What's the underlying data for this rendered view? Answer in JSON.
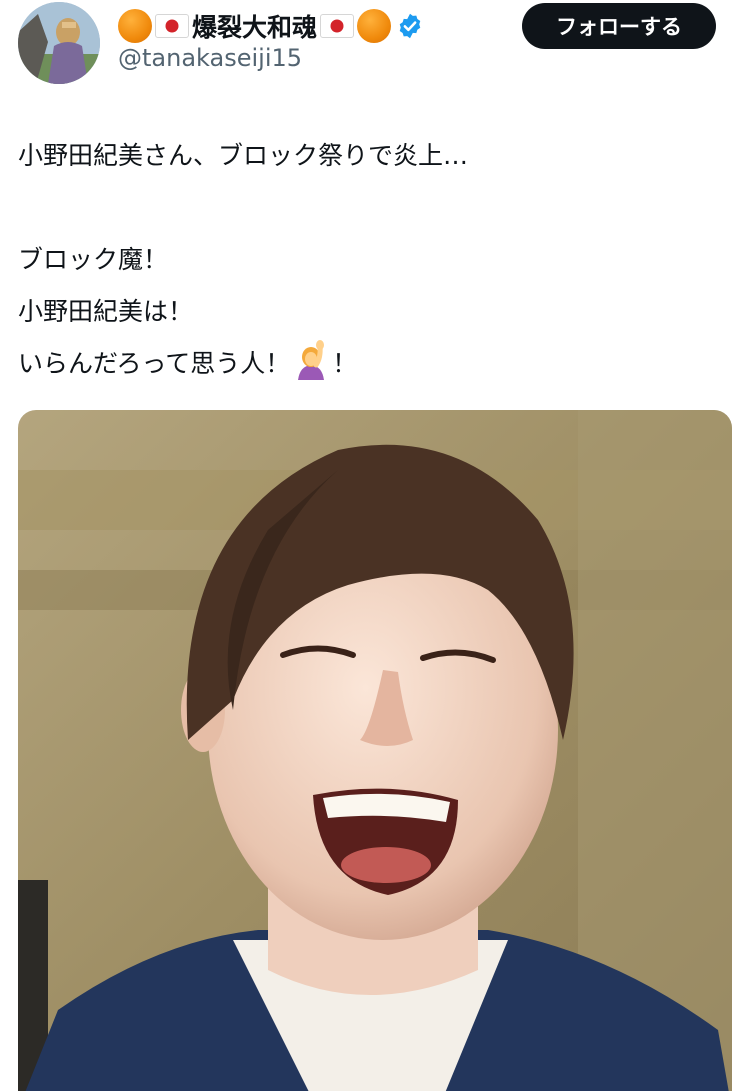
{
  "author": {
    "display_name": "爆裂大和魂",
    "handle": "@tanakaseiji15",
    "verified_icon": "verified-badge-icon",
    "name_decorations": [
      "orange-circle-emoji",
      "japan-flag-emoji"
    ]
  },
  "follow_button": {
    "label": "フォローする"
  },
  "tweet": {
    "lines": [
      "小野田紀美さん、ブロック祭りで炎上…",
      "",
      "ブロック魔！",
      "小野田紀美は！",
      "いらんだろって思う人！"
    ],
    "last_line_suffix": "！",
    "emoji": "person-raising-hand-emoji"
  },
  "media": {
    "kind": "photo",
    "subject": "laughing-person-photo"
  },
  "colors": {
    "text": "#0f1419",
    "secondary": "#536471",
    "button_bg": "#0f1419",
    "button_text": "#ffffff",
    "verified": "#1d9bf0"
  }
}
